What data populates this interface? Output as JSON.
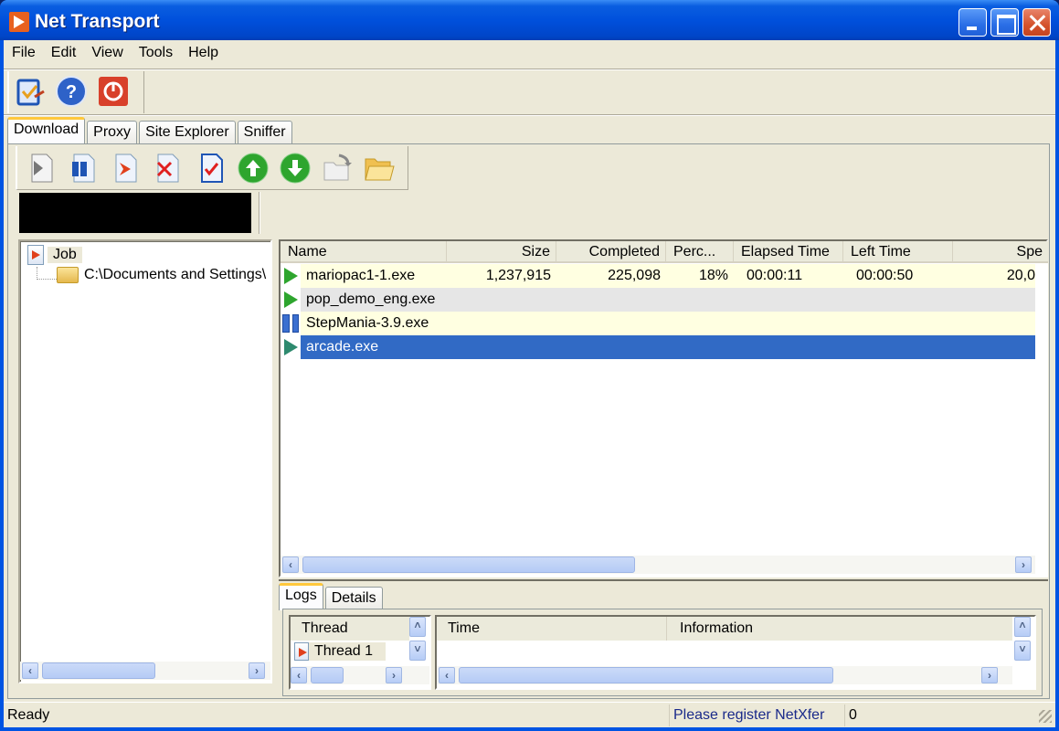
{
  "window": {
    "title": "Net Transport",
    "controls": {
      "minimize": "minimize",
      "maximize": "maximize",
      "close": "close"
    }
  },
  "menu": [
    "File",
    "Edit",
    "View",
    "Tools",
    "Help"
  ],
  "main_toolbar": [
    {
      "icon": "options-icon",
      "label": "Options"
    },
    {
      "icon": "help-icon",
      "label": "Help"
    },
    {
      "icon": "power-icon",
      "label": "Exit"
    }
  ],
  "tabs": [
    {
      "label": "Download",
      "active": true
    },
    {
      "label": "Proxy",
      "active": false
    },
    {
      "label": "Site Explorer",
      "active": false
    },
    {
      "label": "Sniffer",
      "active": false
    }
  ],
  "download_toolbar": [
    {
      "icon": "start-icon"
    },
    {
      "icon": "pause-icon"
    },
    {
      "icon": "new-download-icon"
    },
    {
      "icon": "delete-icon"
    },
    {
      "icon": "complete-icon"
    },
    {
      "icon": "move-up-icon"
    },
    {
      "icon": "move-down-icon"
    },
    {
      "icon": "move-folder-icon"
    },
    {
      "icon": "open-folder-icon"
    }
  ],
  "tree": {
    "root": "Job",
    "child": "C:\\Documents and Settings\\"
  },
  "download_list": {
    "columns": [
      "Name",
      "Size",
      "Completed",
      "Perc...",
      "Elapsed Time",
      "Left Time",
      "Spe"
    ],
    "rows": [
      {
        "status": "running",
        "name": "mariopac1-1.exe",
        "size": "1,237,915",
        "completed": "225,098",
        "percent": "18%",
        "elapsed": "00:00:11",
        "left": "00:00:50",
        "speed": "20,0"
      },
      {
        "status": "running",
        "name": "pop_demo_eng.exe",
        "size": "",
        "completed": "",
        "percent": "",
        "elapsed": "",
        "left": "",
        "speed": ""
      },
      {
        "status": "paused",
        "name": "StepMania-3.9.exe",
        "size": "",
        "completed": "",
        "percent": "",
        "elapsed": "",
        "left": "",
        "speed": ""
      },
      {
        "status": "running",
        "name": "arcade.exe",
        "size": "",
        "completed": "",
        "percent": "",
        "elapsed": "",
        "left": "",
        "speed": "",
        "selected": true
      }
    ]
  },
  "bottom_tabs": [
    {
      "label": "Logs",
      "active": true
    },
    {
      "label": "Details",
      "active": false
    }
  ],
  "threads": {
    "header": "Thread",
    "items": [
      "Thread 1"
    ]
  },
  "logs": {
    "columns": [
      "Time",
      "Information"
    ]
  },
  "status_bar": {
    "left": "Ready",
    "middle": "Please register NetXfer",
    "right": "0"
  },
  "colors": {
    "title_bar": "#0054e3",
    "row_alt_yellow": "#ffffe1",
    "row_alt_gray": "#e6e6e6",
    "selection": "#316ac5",
    "status_link": "#1a2a8a"
  }
}
